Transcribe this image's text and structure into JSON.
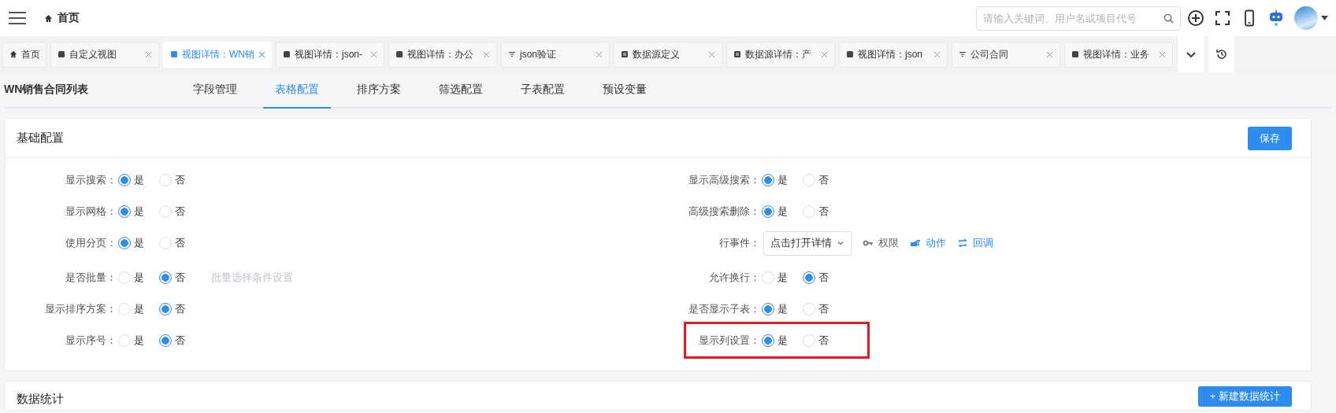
{
  "header": {
    "breadcrumb": "首页",
    "search": {
      "placeholder": "请输入关键词、用户名或项目代号"
    }
  },
  "tabs": [
    {
      "label": "首页",
      "kind": "home",
      "closable": false,
      "selected": false
    },
    {
      "label": "自定义视图",
      "kind": "view",
      "closable": true,
      "selected": false
    },
    {
      "label": "视图详情：WN销",
      "kind": "view",
      "closable": true,
      "selected": true
    },
    {
      "label": "视图详情：json-",
      "kind": "view",
      "closable": true,
      "selected": false
    },
    {
      "label": "视图详情：办公",
      "kind": "view",
      "closable": true,
      "selected": false
    },
    {
      "label": "json验证",
      "kind": "filter",
      "closable": true,
      "selected": false
    },
    {
      "label": "数据源定义",
      "kind": "datasource",
      "closable": true,
      "selected": false
    },
    {
      "label": "数据源详情：产",
      "kind": "datasource",
      "closable": true,
      "selected": false
    },
    {
      "label": "视图详情：json",
      "kind": "view",
      "closable": true,
      "selected": false
    },
    {
      "label": "公司合同",
      "kind": "filter",
      "closable": true,
      "selected": false
    },
    {
      "label": "视图详情：业务",
      "kind": "view",
      "closable": true,
      "selected": false
    }
  ],
  "page": {
    "title": "WN销售合同列表",
    "sub_tabs": [
      {
        "label": "字段管理",
        "selected": false
      },
      {
        "label": "表格配置",
        "selected": true
      },
      {
        "label": "排序方案",
        "selected": false
      },
      {
        "label": "筛选配置",
        "selected": false
      },
      {
        "label": "子表配置",
        "selected": false
      },
      {
        "label": "预设变量",
        "selected": false
      }
    ]
  },
  "basic_config": {
    "title": "基础配置",
    "save_button": "保存",
    "left": [
      {
        "kind": "radio",
        "label": "显示搜索：",
        "options": [
          {
            "label": "是",
            "selected": true
          },
          {
            "label": "否",
            "selected": false
          }
        ]
      },
      {
        "kind": "radio",
        "label": "显示网格：",
        "options": [
          {
            "label": "是",
            "selected": true
          },
          {
            "label": "否",
            "selected": false
          }
        ]
      },
      {
        "kind": "radio",
        "label": "使用分页：",
        "options": [
          {
            "label": "是",
            "selected": true
          },
          {
            "label": "否",
            "selected": false
          }
        ]
      },
      {
        "kind": "radio",
        "label": "是否批量：",
        "options": [
          {
            "label": "是",
            "selected": false
          },
          {
            "label": "否",
            "selected": true
          }
        ],
        "link": {
          "label": "批量选择条件设置",
          "disabled": true
        }
      },
      {
        "kind": "radio",
        "label": "显示排序方案：",
        "options": [
          {
            "label": "是",
            "selected": false
          },
          {
            "label": "否",
            "selected": true
          }
        ]
      },
      {
        "kind": "radio",
        "label": "显示序号：",
        "options": [
          {
            "label": "是",
            "selected": false
          },
          {
            "label": "否",
            "selected": true
          }
        ]
      }
    ],
    "right": [
      {
        "kind": "radio",
        "label": "显示高级搜索：",
        "highlighted": false,
        "options": [
          {
            "label": "是",
            "selected": true
          },
          {
            "label": "否",
            "selected": false
          }
        ]
      },
      {
        "kind": "radio",
        "label": "高级搜索删除：",
        "highlighted": false,
        "options": [
          {
            "label": "是",
            "selected": true
          },
          {
            "label": "否",
            "selected": false
          }
        ]
      },
      {
        "kind": "event",
        "label": "行事件：",
        "highlighted": false,
        "value": "点击打开详情",
        "actions": [
          {
            "label": "权限",
            "disabled": true
          },
          {
            "label": "动作",
            "disabled": false
          },
          {
            "label": "回调",
            "disabled": false
          }
        ]
      },
      {
        "kind": "radio",
        "label": "允许换行：",
        "highlighted": false,
        "options": [
          {
            "label": "是",
            "selected": false
          },
          {
            "label": "否",
            "selected": true
          }
        ]
      },
      {
        "kind": "radio",
        "label": "是否显示子表：",
        "highlighted": false,
        "options": [
          {
            "label": "是",
            "selected": true
          },
          {
            "label": "否",
            "selected": false
          }
        ]
      },
      {
        "kind": "radio",
        "label": "显示列设置：",
        "highlighted": true,
        "options": [
          {
            "label": "是",
            "selected": true
          },
          {
            "label": "否",
            "selected": false
          }
        ]
      }
    ]
  },
  "stats": {
    "title": "数据统计",
    "new_button": "+ 新建数据统计"
  }
}
